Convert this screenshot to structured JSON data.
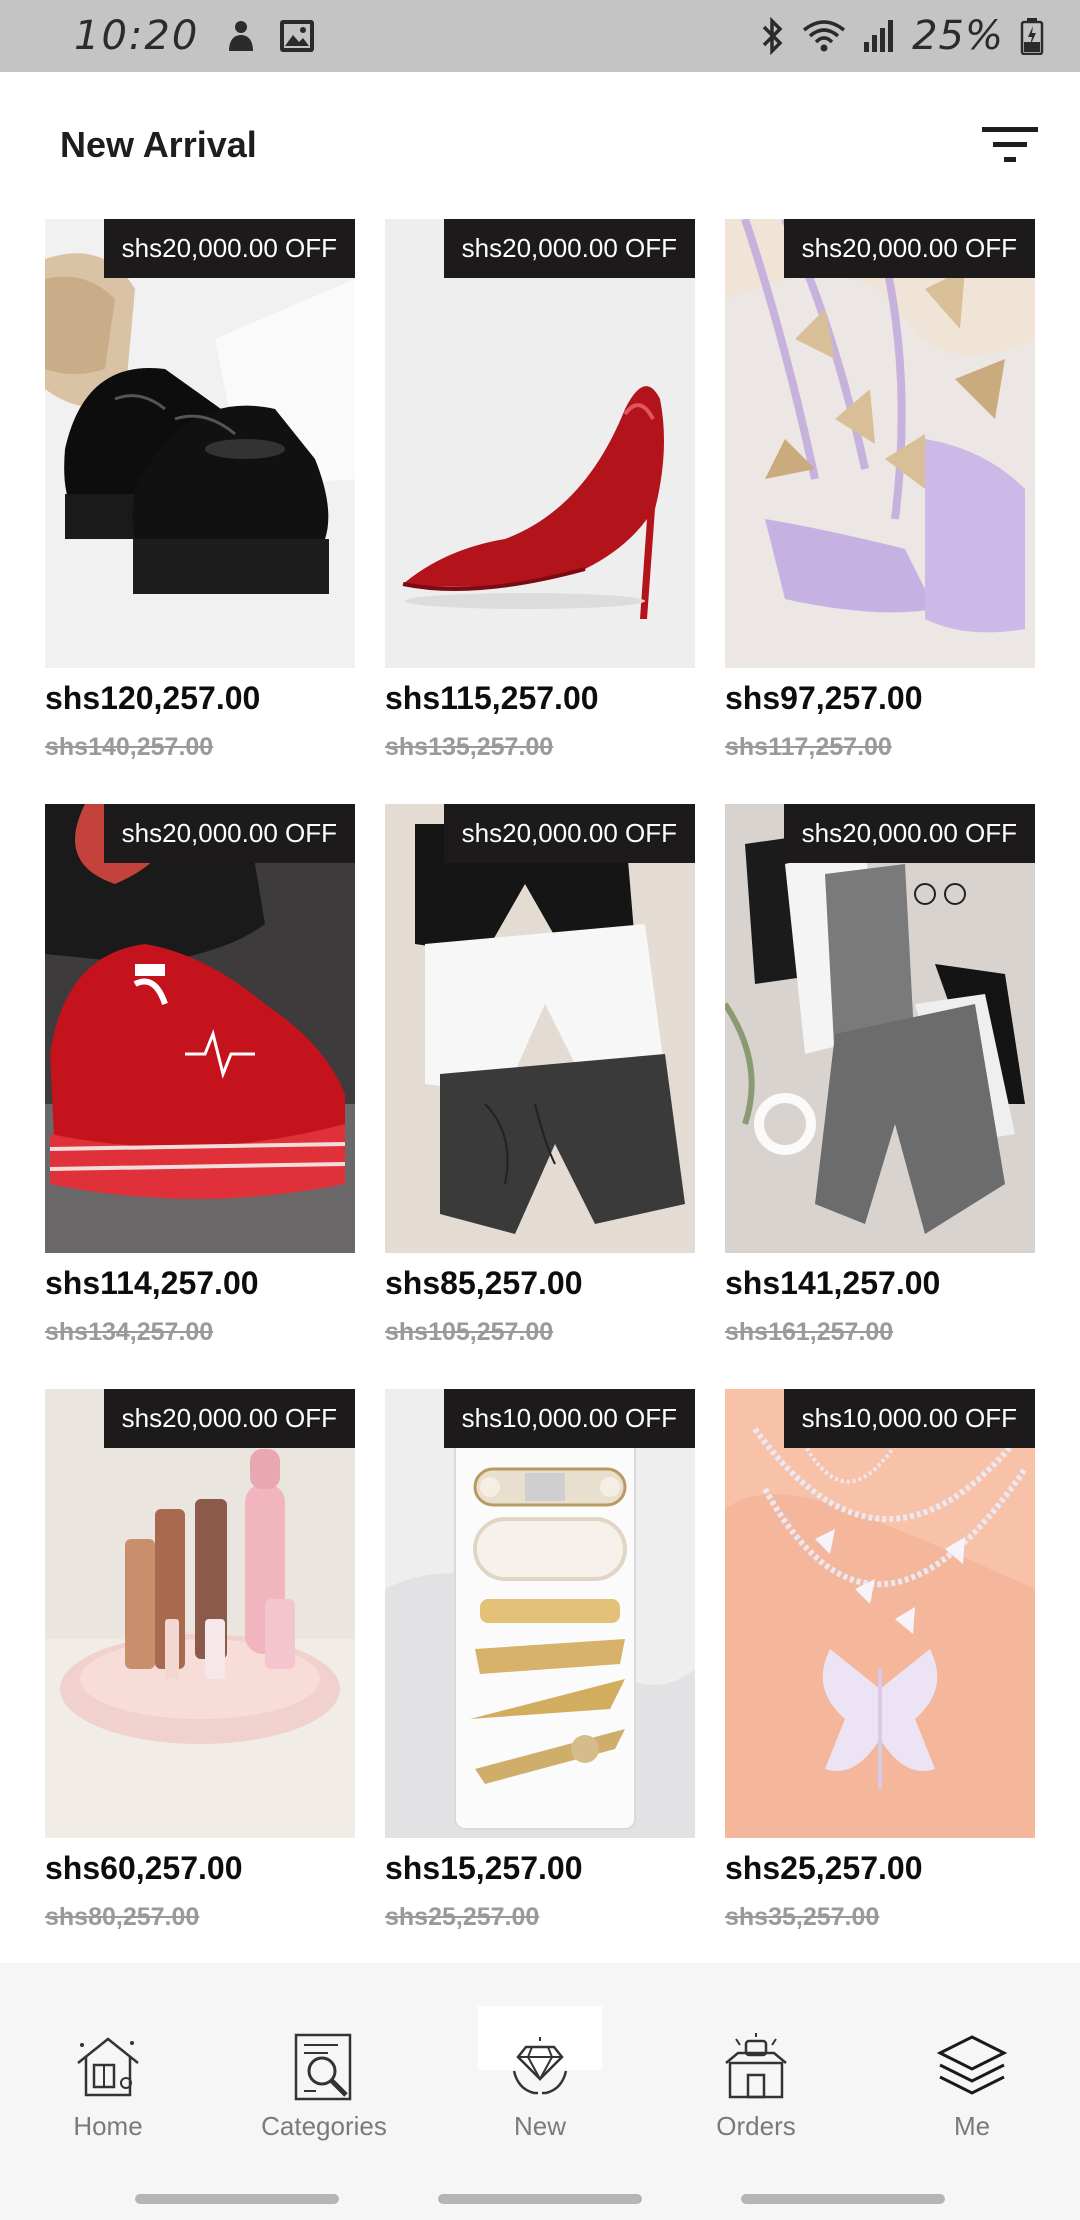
{
  "status_bar": {
    "time": "10:20",
    "battery_text": "25%",
    "icons": [
      "notification-person-icon",
      "image-icon",
      "bluetooth-icon",
      "wifi-icon",
      "signal-icon",
      "battery-icon"
    ]
  },
  "header": {
    "title": "New Arrival",
    "filter_icon": "filter-icon"
  },
  "products": [
    {
      "badge": "shs20,000.00 OFF",
      "price": "shs120,257.00",
      "old_price": "shs140,257.00",
      "image": "black-platform-oxford-shoes"
    },
    {
      "badge": "shs20,000.00 OFF",
      "price": "shs115,257.00",
      "old_price": "shs135,257.00",
      "image": "red-stiletto-pump"
    },
    {
      "badge": "shs20,000.00 OFF",
      "price": "shs97,257.00",
      "old_price": "shs117,257.00",
      "image": "lilac-butterfly-heeled-sandals"
    },
    {
      "badge": "shs20,000.00 OFF",
      "price": "shs114,257.00",
      "old_price": "shs134,257.00",
      "image": "red-platform-sneakers"
    },
    {
      "badge": "shs20,000.00 OFF",
      "price": "shs85,257.00",
      "old_price": "shs105,257.00",
      "image": "three-pack-shorts"
    },
    {
      "badge": "shs20,000.00 OFF",
      "price": "shs141,257.00",
      "old_price": "shs161,257.00",
      "image": "tank-top-and-joggers-set"
    },
    {
      "badge": "shs20,000.00 OFF",
      "price": "shs60,257.00",
      "old_price": "shs80,257.00",
      "image": "makeup-organizer-tray"
    },
    {
      "badge": "shs10,000.00 OFF",
      "price": "shs15,257.00",
      "old_price": "shs25,257.00",
      "image": "hair-clip-set"
    },
    {
      "badge": "shs10,000.00 OFF",
      "price": "shs25,257.00",
      "old_price": "shs35,257.00",
      "image": "butterfly-layered-necklace"
    }
  ],
  "colors": {
    "status_bar_bg": "#c4c4c4",
    "badge_bg": "#1c1a1a",
    "old_price": "#9a9a9a",
    "nav_bg": "#f6f6f6"
  },
  "bottom_nav": {
    "items": [
      {
        "label": "Home",
        "icon": "home-icon"
      },
      {
        "label": "Categories",
        "icon": "categories-icon"
      },
      {
        "label": "New",
        "icon": "diamond-icon",
        "active": true
      },
      {
        "label": "Orders",
        "icon": "orders-box-icon"
      },
      {
        "label": "Me",
        "icon": "layers-icon"
      }
    ]
  }
}
